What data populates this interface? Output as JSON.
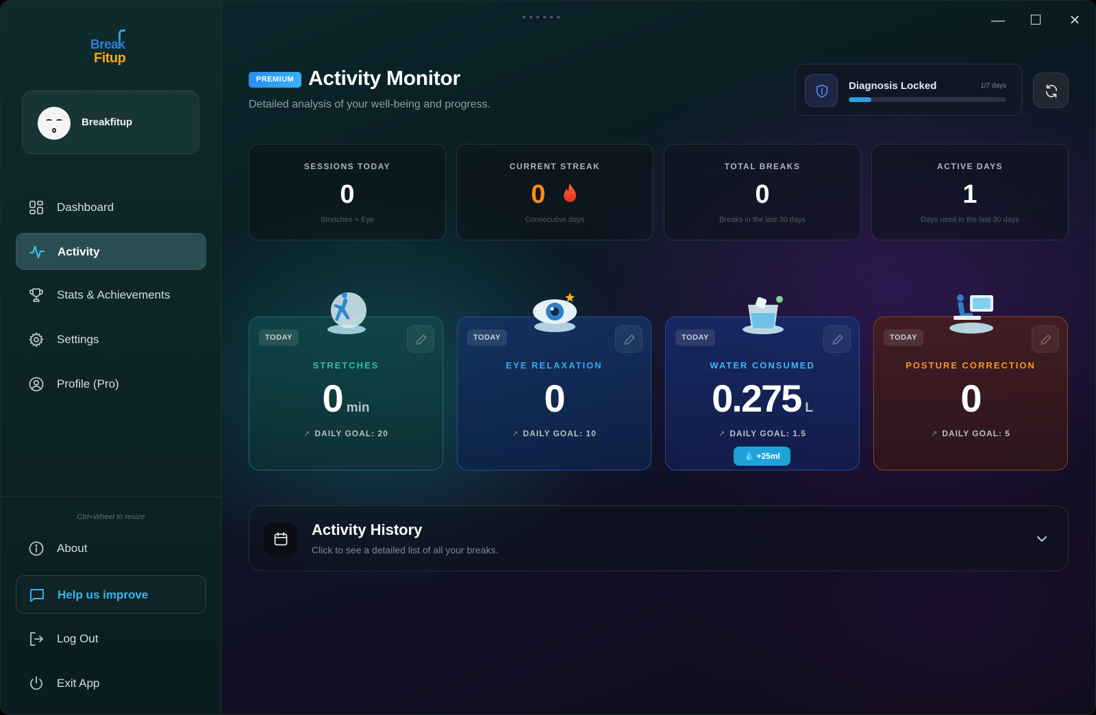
{
  "window": {
    "controls": {
      "minimize": "—",
      "maximize": "☐",
      "close": "✕"
    }
  },
  "sidebar": {
    "logo": {
      "line1": "Break",
      "line2": "Fitup"
    },
    "profile": {
      "name": "Breakfitup"
    },
    "nav": [
      {
        "label": "Dashboard",
        "icon": "dashboard-grid-icon",
        "active": false
      },
      {
        "label": "Activity",
        "icon": "activity-pulse-icon",
        "active": true
      },
      {
        "label": "Stats & Achievements",
        "icon": "trophy-icon",
        "active": false
      },
      {
        "label": "Settings",
        "icon": "gear-icon",
        "active": false
      },
      {
        "label": "Profile (Pro)",
        "icon": "user-circle-icon",
        "active": false
      }
    ],
    "resize_hint": "Ctrl+Wheel to resize",
    "footer": {
      "about": "About",
      "help": "Help us improve",
      "logout": "Log Out",
      "exit": "Exit App"
    }
  },
  "header": {
    "badge": "PREMIUM",
    "title": "Activity Monitor",
    "subtitle": "Detailed analysis of your well-being and progress."
  },
  "diagnosis": {
    "title": "Diagnosis Locked",
    "days": "1/7 days",
    "progress": 0.143
  },
  "stats": [
    {
      "label": "SESSIONS TODAY",
      "value": "0",
      "sub": "Stretches + Eye"
    },
    {
      "label": "CURRENT STREAK",
      "value": "0",
      "sub": "Consecutive days"
    },
    {
      "label": "TOTAL BREAKS",
      "value": "0",
      "sub": "Breaks in the last 30 days"
    },
    {
      "label": "ACTIVE DAYS",
      "value": "1",
      "sub": "Days used in the last 30 days"
    }
  ],
  "activities": [
    {
      "badge": "TODAY",
      "title": "STRETCHES",
      "value": "0",
      "unit": "min",
      "goal": "DAILY GOAL: 20",
      "color": "#29c2a4"
    },
    {
      "badge": "TODAY",
      "title": "EYE RELAXATION",
      "value": "0",
      "unit": "",
      "goal": "DAILY GOAL: 10",
      "color": "#3aa8f0"
    },
    {
      "badge": "TODAY",
      "title": "WATER CONSUMED",
      "value": "0.275",
      "unit": "L",
      "goal": "DAILY GOAL: 1.5",
      "color": "#3cb8f2",
      "action": "+25ml"
    },
    {
      "badge": "TODAY",
      "title": "POSTURE CORRECTION",
      "value": "0",
      "unit": "",
      "goal": "DAILY GOAL: 5",
      "color": "#f39a1c"
    }
  ],
  "history": {
    "title": "Activity History",
    "subtitle": "Click to see a detailed list of all your breaks."
  },
  "colors": {
    "accent": "#2da0de",
    "streak": "#ff8a1f",
    "help": "#3bb6ef"
  }
}
